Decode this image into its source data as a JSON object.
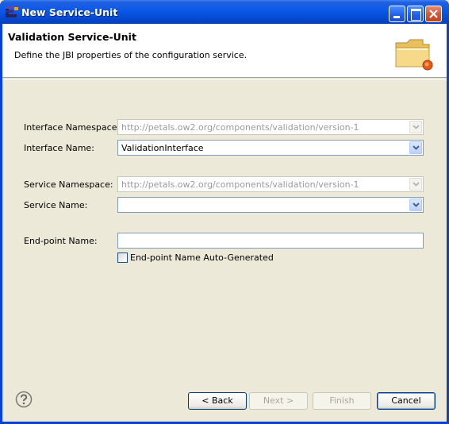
{
  "window": {
    "title": "New Service-Unit"
  },
  "header": {
    "title": "Validation Service-Unit",
    "description": "Define the JBI properties of the configuration service."
  },
  "form": {
    "interface_namespace": {
      "label": "Interface Namespace:",
      "value": "http://petals.ow2.org/components/validation/version-1",
      "enabled": false
    },
    "interface_name": {
      "label": "Interface Name:",
      "value": "ValidationInterface",
      "enabled": true
    },
    "service_namespace": {
      "label": "Service Namespace:",
      "value": "http://petals.ow2.org/components/validation/version-1",
      "enabled": false
    },
    "service_name": {
      "label": "Service Name:",
      "value": "",
      "enabled": true
    },
    "endpoint_name": {
      "label": "End-point Name:",
      "value": ""
    },
    "endpoint_auto": {
      "label": "End-point Name Auto-Generated",
      "checked": false
    }
  },
  "buttons": {
    "back": "< Back",
    "next": "Next >",
    "finish": "Finish",
    "cancel": "Cancel"
  },
  "icons": {
    "app": "eclipse-icon",
    "minimize": "minimize-icon",
    "maximize": "maximize-icon",
    "close": "close-icon",
    "header": "folder-icon",
    "help": "help-icon"
  }
}
